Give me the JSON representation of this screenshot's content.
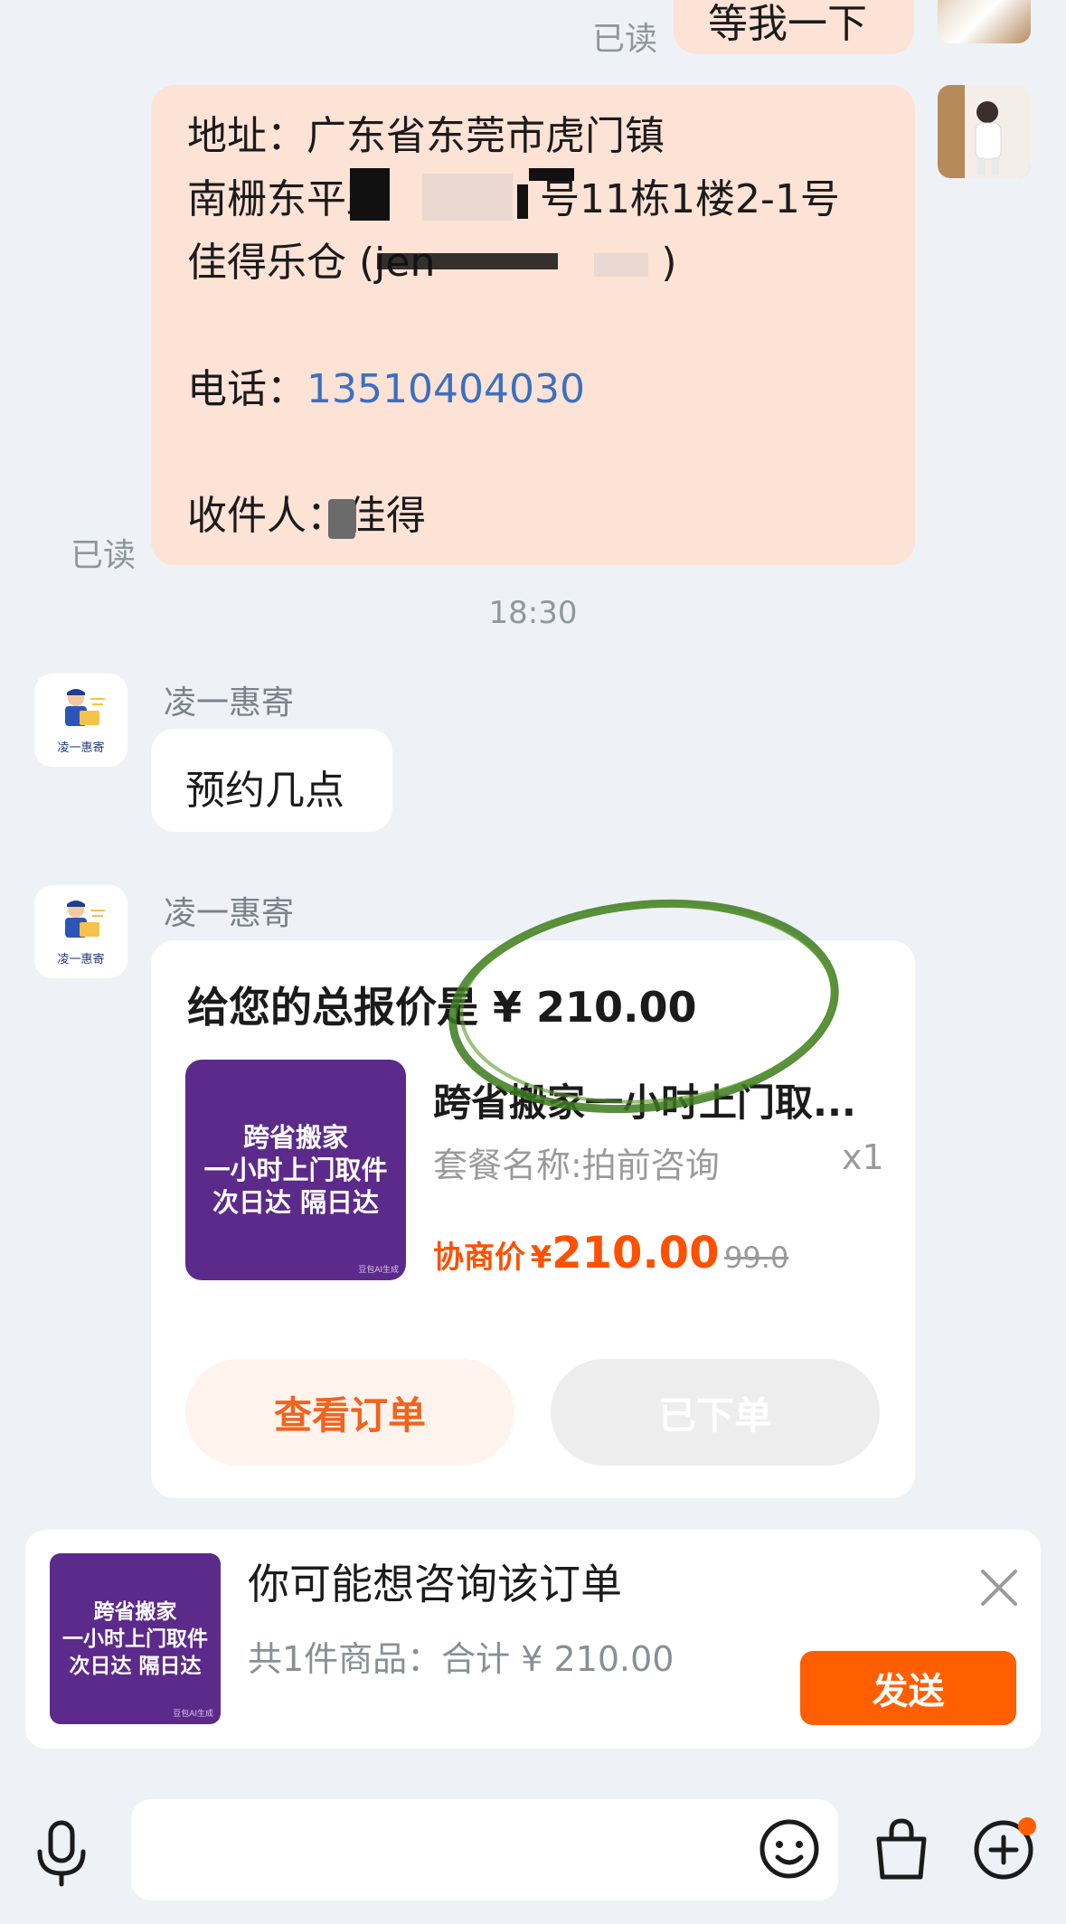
{
  "top": {
    "read_label": "已读",
    "user_message_partial": "等我一下"
  },
  "address_message": {
    "address_prefix": "地址：广东省东莞市虎门镇",
    "address_line2_a": "南栅东平路",
    "address_line2_b": "号11栋1楼2-1号",
    "address_line3_a": "佳得乐仓 (jen",
    "address_line3_b": ")",
    "phone_label": "电话：",
    "phone_number": "13510404030",
    "receiver_label": "收件人：佳得",
    "read_label": "已读"
  },
  "timestamp": "18:30",
  "merchant": {
    "name": "凌一惠寄",
    "avatar_caption": "凌一惠寄"
  },
  "message_appointment": "预约几点",
  "quote_card": {
    "title": "给您的总报价是 ¥ 210.00",
    "thumb_lines": [
      "跨省搬家",
      "一小时上门取件",
      "次日达 隔日达"
    ],
    "thumb_footnote": "豆包AI生成",
    "product_name": "跨省搬家一小时上门取...",
    "package_label": "套餐名称:拍前咨询",
    "quantity": "x1",
    "negotiated_label": "协商价",
    "currency": "¥",
    "price": "210.00",
    "original_price": "99.0",
    "view_order_button": "查看订单",
    "ordered_button": "已下单"
  },
  "suggest_card": {
    "title": "你可能想咨询该订单",
    "summary": "共1件商品：合计 ¥ 210.00",
    "send_button": "发送",
    "thumb_lines": [
      "跨省搬家",
      "一小时上门取件",
      "次日达 隔日达"
    ],
    "thumb_footnote": "豆包AI生成"
  },
  "input_bar": {
    "voice_icon": "microphone-icon",
    "emoji_icon": "smiley-icon",
    "bag_icon": "shopping-bag-icon",
    "plus_icon": "plus-circle-icon",
    "notification_color": "#ff5f00"
  },
  "colors": {
    "accent": "#ff5f00",
    "user_bubble": "#fde2d6",
    "phone_link": "#3d6fbf",
    "annotation_circle": "#3c7a1e"
  }
}
